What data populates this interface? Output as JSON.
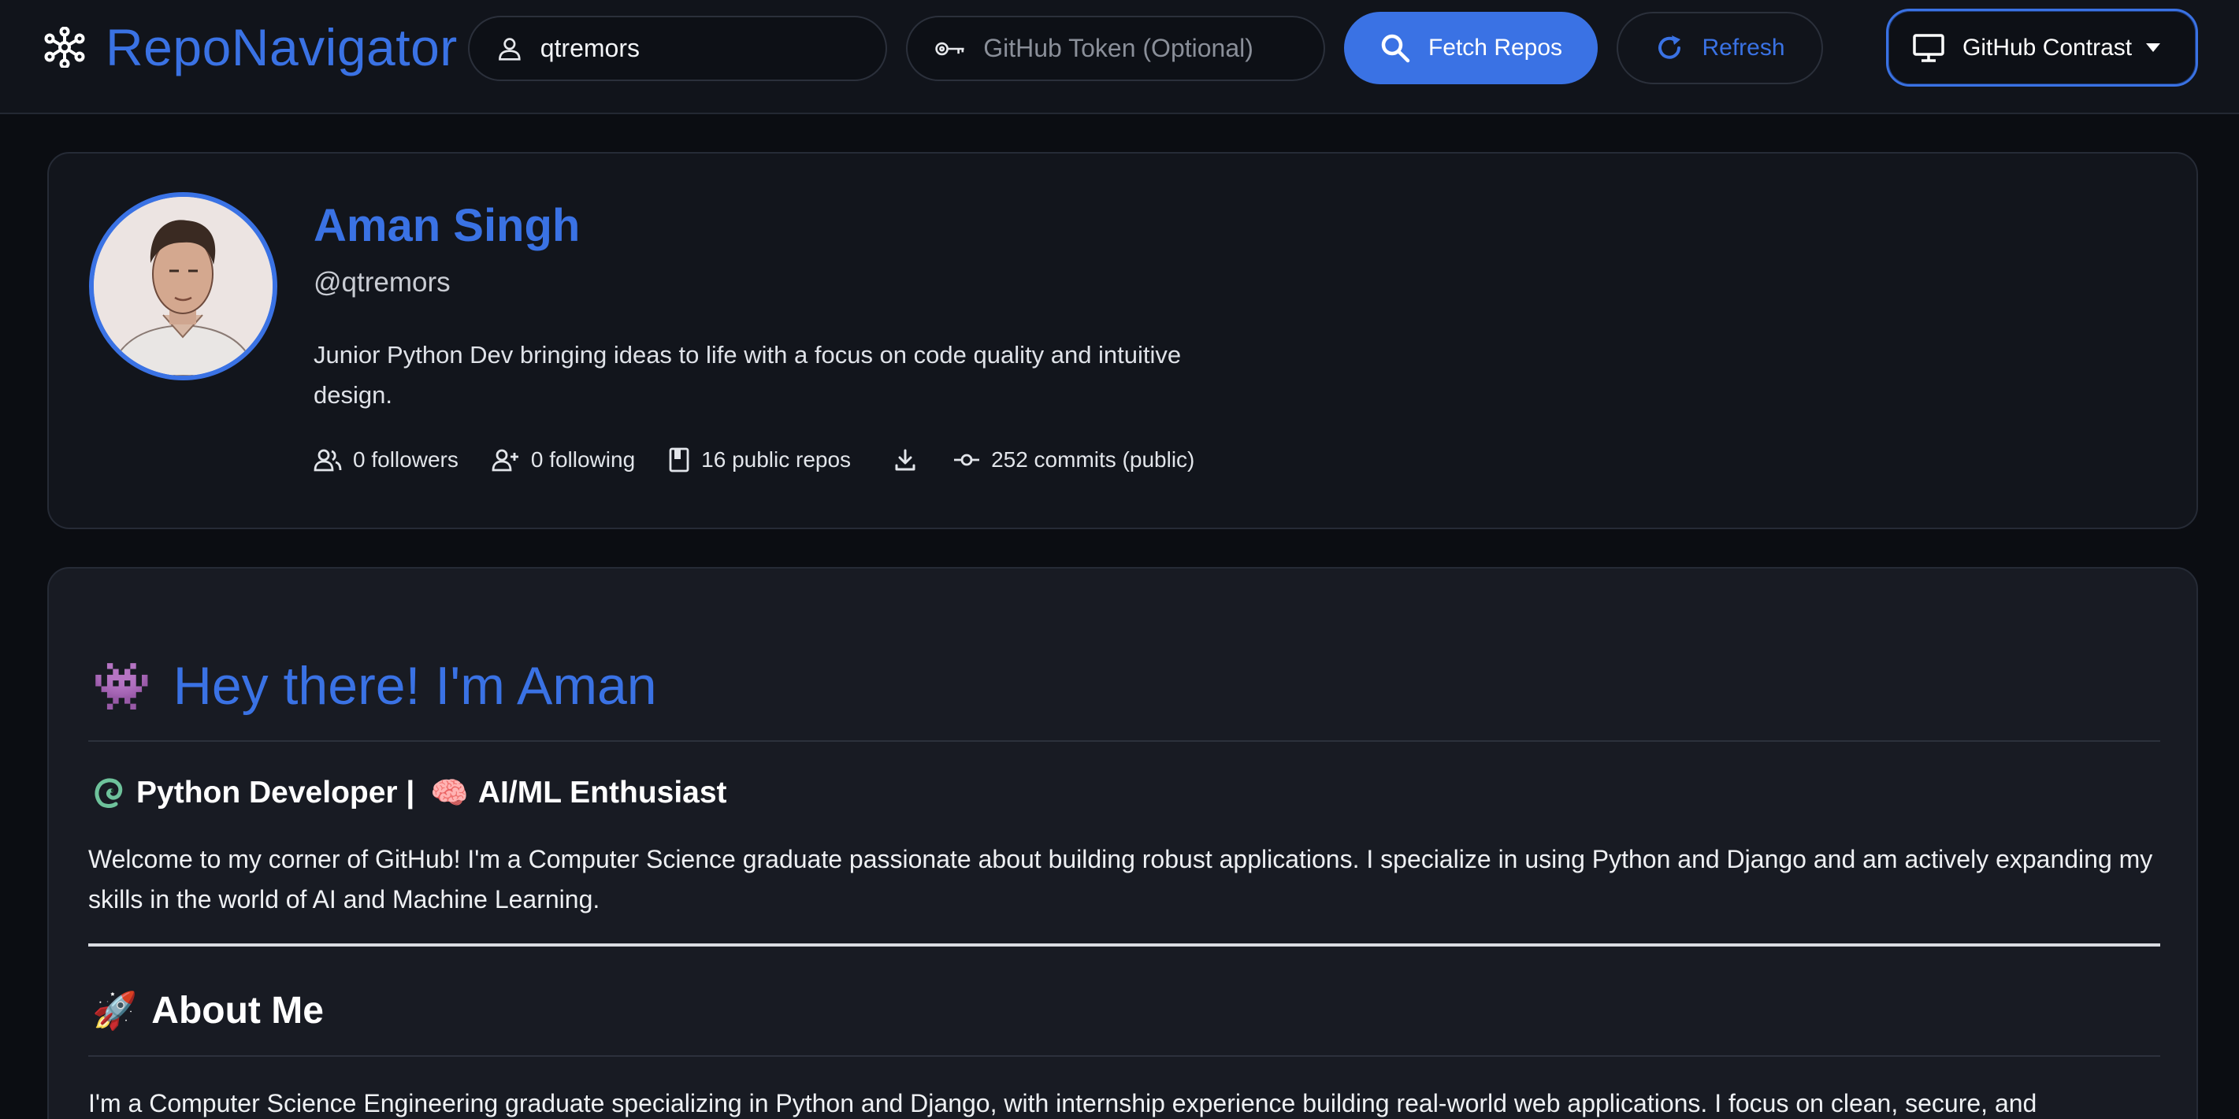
{
  "header": {
    "brand": "RepoNavigator",
    "username_value": "qtremors",
    "token_placeholder": "GitHub Token (Optional)",
    "fetch_label": "Fetch Repos",
    "refresh_label": "Refresh",
    "theme_label": "GitHub Contrast"
  },
  "colors": {
    "accent": "#3a72e4",
    "background": "#0b0d12",
    "card": "#12151c"
  },
  "profile": {
    "name": "Aman Singh",
    "handle": "@qtremors",
    "bio": "Junior Python Dev bringing ideas to life with a focus on code quality and intuitive design.",
    "followers": "0 followers",
    "following": "0 following",
    "repos": "16 public repos",
    "commits": "252 commits (public)"
  },
  "readme": {
    "title_emoji": "👾",
    "title": "Hey there! I'm Aman",
    "subtitle_part1": "Python Developer |",
    "subtitle_emoji": "🧠",
    "subtitle_part2": "AI/ML Enthusiast",
    "welcome": "Welcome to my corner of GitHub! I'm a Computer Science graduate passionate about building robust applications. I specialize in using Python and Django and am actively expanding my skills in the world of AI and Machine Learning.",
    "about_emoji": "🚀",
    "about_heading": "About Me",
    "about_text": "I'm a Computer Science Engineering graduate specializing in Python and Django, with internship experience building real-world web applications. I focus on clean, secure, and"
  }
}
